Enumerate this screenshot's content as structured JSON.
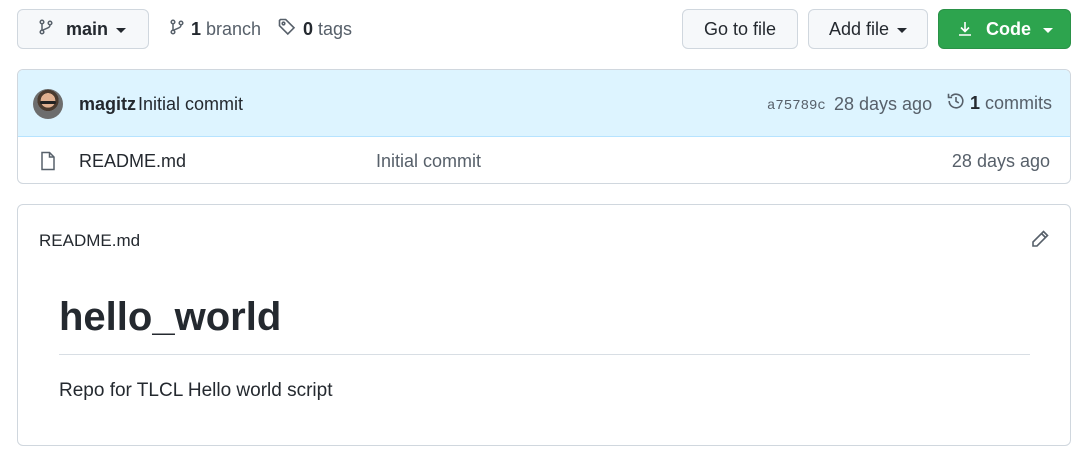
{
  "toolbar": {
    "branch_button": {
      "label": "main",
      "icon": "git-branch-icon"
    },
    "branches": {
      "count": "1",
      "label": "branch",
      "icon": "git-branch-icon"
    },
    "tags": {
      "count": "0",
      "label": "tags",
      "icon": "tag-icon"
    },
    "go_to_file_label": "Go to file",
    "add_file_label": "Add file",
    "code_button": {
      "label": "Code",
      "icon": "download-icon",
      "color": "#2da44e"
    }
  },
  "latest_commit": {
    "author": "magitz",
    "message": "Initial commit",
    "sha": "a75789c",
    "age": "28 days ago",
    "commit_count": "1",
    "commit_count_label": "commits",
    "icon": "history-icon"
  },
  "files": [
    {
      "name": "README.md",
      "message": "Initial commit",
      "age": "28 days ago",
      "icon": "file-icon"
    }
  ],
  "readme": {
    "filename": "README.md",
    "heading": "hello_world",
    "paragraph": "Repo for TLCL Hello world script",
    "edit_icon": "pencil-icon"
  }
}
